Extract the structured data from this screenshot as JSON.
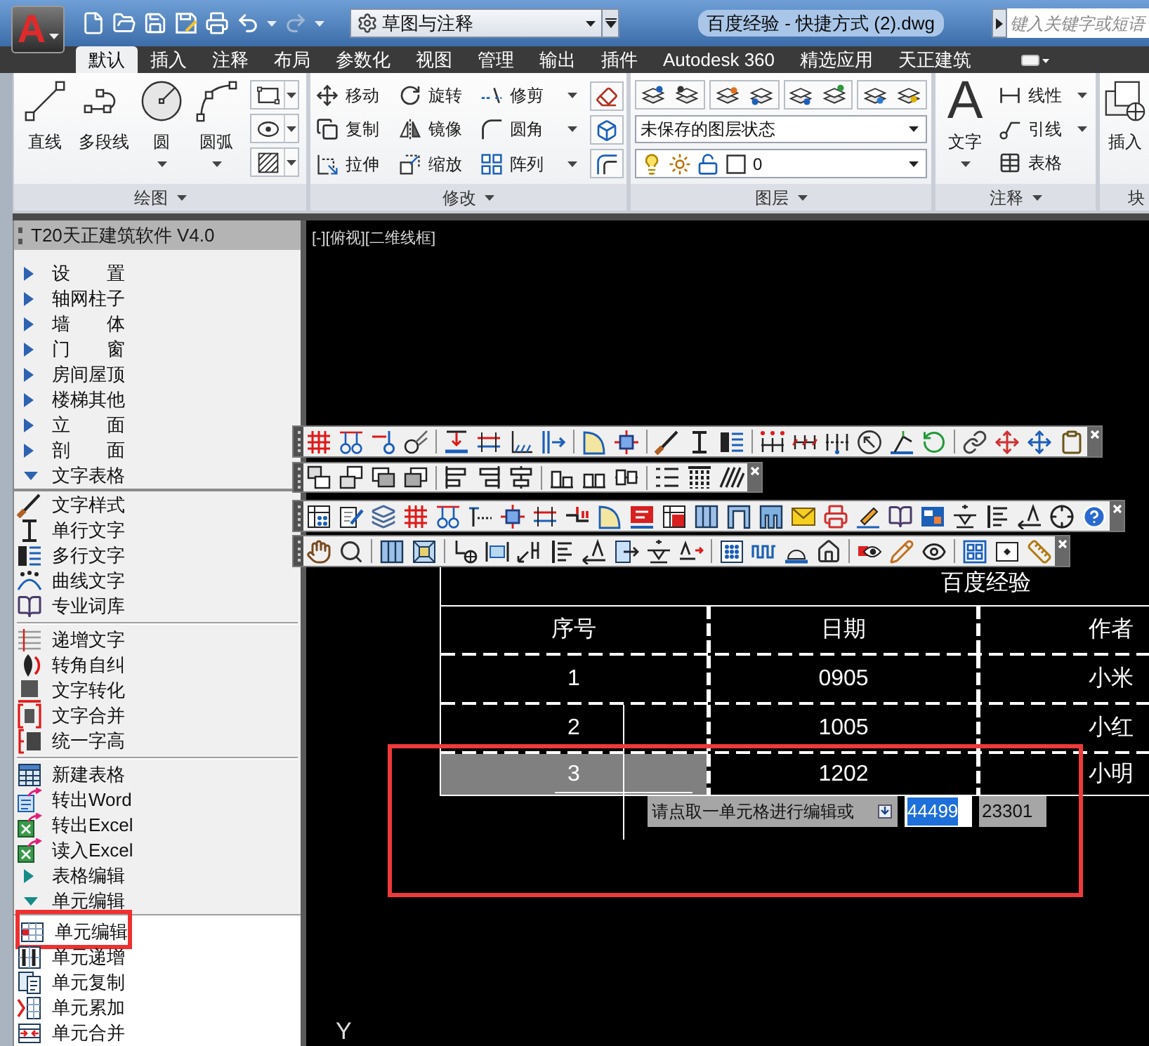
{
  "app_menu": {
    "glyph": "A"
  },
  "quick_access": {
    "redo": {
      "disabled": true
    }
  },
  "workspace": {
    "value": "草图与注释"
  },
  "window": {
    "title": "百度经验 - 快捷方式 (2).dwg"
  },
  "search": {
    "placeholder": "键入关键字或短语"
  },
  "ribbon": {
    "tabs": [
      {
        "label": "默认",
        "selected": true
      },
      {
        "label": "插入",
        "selected": false
      },
      {
        "label": "注释",
        "selected": false
      },
      {
        "label": "布局",
        "selected": false
      },
      {
        "label": "参数化",
        "selected": false
      },
      {
        "label": "视图",
        "selected": false
      },
      {
        "label": "管理",
        "selected": false
      },
      {
        "label": "输出",
        "selected": false
      },
      {
        "label": "插件",
        "selected": false
      },
      {
        "label": "Autodesk 360",
        "selected": false
      },
      {
        "label": "精选应用",
        "selected": false
      },
      {
        "label": "天正建筑",
        "selected": false
      }
    ],
    "panels": [
      {
        "kind": "draw",
        "title": "绘图",
        "menu": true,
        "large": [
          {
            "label": "直线",
            "dropdown": false
          },
          {
            "label": "多段线",
            "dropdown": false
          },
          {
            "label": "圆",
            "dropdown": true
          },
          {
            "label": "圆弧",
            "dropdown": true
          }
        ]
      },
      {
        "kind": "modify",
        "title": "修改",
        "menu": true,
        "small": [
          {
            "label": "移动",
            "dropdown": false
          },
          {
            "label": "旋转",
            "dropdown": false
          },
          {
            "label": "修剪",
            "dropdown": true
          },
          {
            "label": "复制",
            "dropdown": false
          },
          {
            "label": "镜像",
            "dropdown": false
          },
          {
            "label": "圆角",
            "dropdown": true
          },
          {
            "label": "拉伸",
            "dropdown": false
          },
          {
            "label": "缩放",
            "dropdown": false
          },
          {
            "label": "阵列",
            "dropdown": true
          }
        ]
      },
      {
        "kind": "layers",
        "title": "图层",
        "menu": true,
        "layer_state": "未保存的图层状态",
        "current_layer": "0"
      },
      {
        "kind": "annotate",
        "title": "注释",
        "menu": true,
        "large": [
          {
            "label": "文字",
            "glyph": "A",
            "dropdown": true
          }
        ],
        "small": [
          {
            "label": "线性",
            "dropdown": true
          },
          {
            "label": "引线",
            "dropdown": true
          },
          {
            "label": "表格",
            "dropdown": false
          }
        ]
      },
      {
        "kind": "block",
        "title": "块",
        "menu": false,
        "large": [
          {
            "label": "插入",
            "dropdown": false
          }
        ]
      }
    ]
  },
  "sidebar": {
    "title": "T20天正建筑软件 V4.0",
    "items": [
      {
        "kind": "folder",
        "label": "设　　置",
        "expanded": false
      },
      {
        "kind": "folder",
        "label": "轴网柱子",
        "expanded": false
      },
      {
        "kind": "folder",
        "label": "墙　　体",
        "expanded": false
      },
      {
        "kind": "folder",
        "label": "门　　窗",
        "expanded": false
      },
      {
        "kind": "folder",
        "label": "房间屋顶",
        "expanded": false
      },
      {
        "kind": "folder",
        "label": "楼梯其他",
        "expanded": false
      },
      {
        "kind": "folder",
        "label": "立　　面",
        "expanded": false
      },
      {
        "kind": "folder",
        "label": "剖　　面",
        "expanded": false
      },
      {
        "kind": "folder",
        "label": "文字表格",
        "expanded": true,
        "children": [
          {
            "kind": "command",
            "label": "文字样式"
          },
          {
            "kind": "command",
            "label": "单行文字"
          },
          {
            "kind": "command",
            "label": "多行文字"
          },
          {
            "kind": "command",
            "label": "曲线文字"
          },
          {
            "kind": "command",
            "label": "专业词库"
          },
          {
            "kind": "separator"
          },
          {
            "kind": "command",
            "label": "递增文字"
          },
          {
            "kind": "command",
            "label": "转角自纠"
          },
          {
            "kind": "command",
            "label": "文字转化"
          },
          {
            "kind": "command",
            "label": "文字合并"
          },
          {
            "kind": "command",
            "label": "统一字高"
          },
          {
            "kind": "separator"
          },
          {
            "kind": "command",
            "label": "新建表格"
          },
          {
            "kind": "command",
            "label": "转出Word"
          },
          {
            "kind": "command",
            "label": "转出Excel"
          },
          {
            "kind": "command",
            "label": "读入Excel"
          },
          {
            "kind": "folder",
            "label": "表格编辑",
            "expanded": false
          },
          {
            "kind": "folder",
            "label": "单元编辑",
            "expanded": true,
            "children": [
              {
                "kind": "command",
                "label": "单元编辑",
                "highlighted": true
              },
              {
                "kind": "command",
                "label": "单元递增",
                "highlighted": false
              },
              {
                "kind": "command",
                "label": "单元复制",
                "highlighted": false
              },
              {
                "kind": "command",
                "label": "单元累加",
                "highlighted": false
              },
              {
                "kind": "command",
                "label": "单元合并",
                "highlighted": false
              }
            ]
          }
        ]
      }
    ]
  },
  "drawing": {
    "viewport_label": "[-][俯视][二维线框]",
    "table": {
      "title": "百度经验",
      "columns": [
        "序号",
        "日期",
        "作者"
      ],
      "rows": [
        {
          "cells": [
            {
              "text": "1",
              "selected": false
            },
            {
              "text": "0905",
              "selected": false
            },
            {
              "text": "小米",
              "selected": false
            }
          ]
        },
        {
          "cells": [
            {
              "text": "2",
              "selected": false
            },
            {
              "text": "1005",
              "selected": false
            },
            {
              "text": "小红",
              "selected": false
            }
          ]
        },
        {
          "cells": [
            {
              "text": "3",
              "selected": true
            },
            {
              "text": "1202",
              "selected": false
            },
            {
              "text": "小明",
              "selected": false
            }
          ]
        }
      ]
    },
    "prompt": {
      "text": "请点取一单元格进行编辑或",
      "fields": [
        {
          "value": "44499",
          "highlighted": true
        },
        {
          "value": "23301",
          "highlighted": false
        }
      ]
    },
    "annotation_frame": true,
    "ucs_label": "Y"
  }
}
